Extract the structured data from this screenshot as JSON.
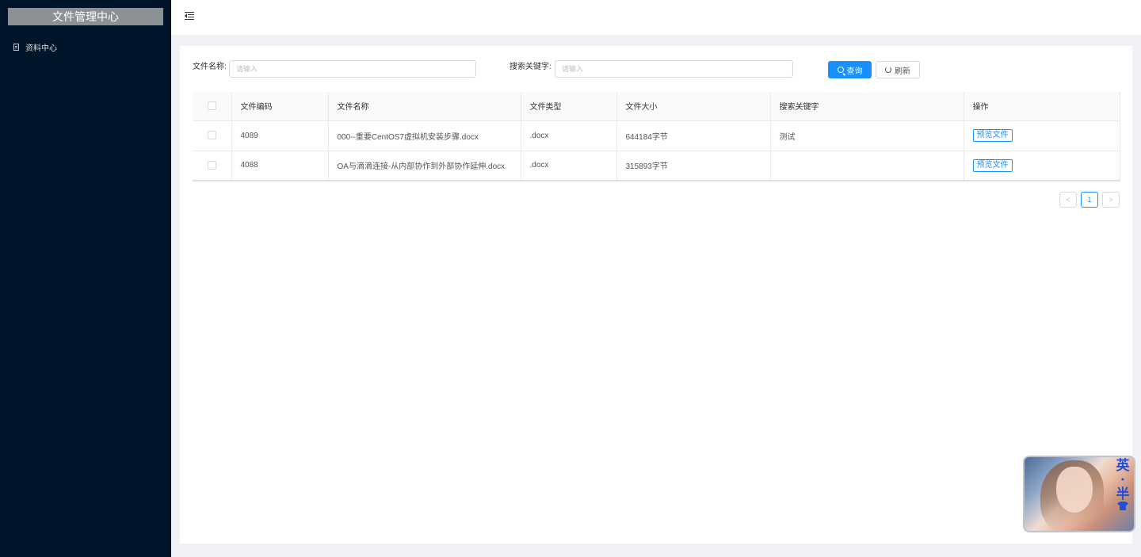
{
  "sidebar": {
    "logo": "文件管理中心",
    "items": [
      {
        "label": "资料中心",
        "icon": "document-icon"
      }
    ]
  },
  "header": {
    "toggle_icon": "menu-fold-icon"
  },
  "search": {
    "file_name_label": "文件名称:",
    "file_name_placeholder": "请输入",
    "file_name_value": "",
    "keyword_label": "搜索关键字:",
    "keyword_placeholder": "请输入",
    "keyword_value": "",
    "query_button": "查询",
    "refresh_button": "刷新"
  },
  "table": {
    "columns": [
      "文件编码",
      "文件名称",
      "文件类型",
      "文件大小",
      "搜索关键字",
      "操作"
    ],
    "rows": [
      {
        "code": "4089",
        "name": "000--重要CentOS7虚拟机安装步骤.docx",
        "type": ".docx",
        "size": "644184字节",
        "keyword": "测试",
        "action": "预览文件"
      },
      {
        "code": "4088",
        "name": "OA与滴滴连接-从内部协作到外部协作延伸.docx",
        "type": ".docx",
        "size": "315893字节",
        "keyword": "",
        "action": "预览文件"
      }
    ]
  },
  "pagination": {
    "prev": "<",
    "current": "1",
    "next": ">"
  },
  "widget": {
    "chars": [
      "英",
      "·",
      "半"
    ],
    "icon": "shirt-icon"
  },
  "colors": {
    "sidebar_bg": "#001529",
    "primary": "#1890ff",
    "page_bg": "#f0f2f5"
  }
}
